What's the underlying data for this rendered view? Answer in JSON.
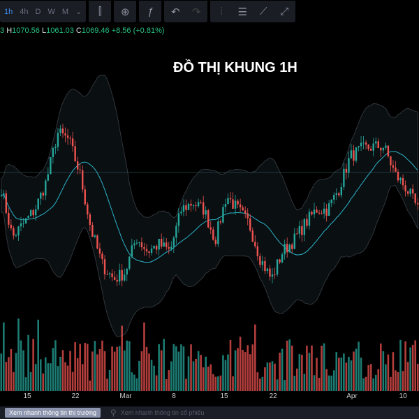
{
  "toolbar": {
    "intervals": [
      "1h",
      "4h",
      "D",
      "W",
      "M"
    ],
    "active_interval": "1h"
  },
  "ohlc": {
    "open_tail": "3",
    "h_label": "H",
    "high": "1070.56",
    "l_label": "L",
    "low": "1061.03",
    "c_label": "C",
    "close": "1069.46",
    "change": "+8.56 (+0.81%)"
  },
  "title": "ĐỒ THỊ KHUNG 1H",
  "x_labels": [
    {
      "t": "15",
      "p": 0.065
    },
    {
      "t": "22",
      "p": 0.18
    },
    {
      "t": "Mar",
      "p": 0.3
    },
    {
      "t": "8",
      "p": 0.415
    },
    {
      "t": "15",
      "p": 0.535
    },
    {
      "t": "22",
      "p": 0.652
    },
    {
      "t": "Apr",
      "p": 0.84
    },
    {
      "t": "10",
      "p": 0.962
    }
  ],
  "bottom": {
    "quick_market": "Xem nhanh thông tin thị trường",
    "search_placeholder": "Xem nhanh thông tin cổ phiếu"
  },
  "colors": {
    "up": "#26a69a",
    "down": "#ef5350",
    "ma": "#2bb3c8",
    "bg": "#000000"
  },
  "chart_data": {
    "type": "candlestick",
    "price_path": [
      1055,
      1020,
      1030,
      1040,
      1060,
      1095,
      1090,
      1065,
      1025,
      1000,
      990,
      995,
      1020,
      1010,
      1015,
      1010,
      1040,
      1045,
      1040,
      1018,
      1050,
      1040,
      1030,
      1005,
      990,
      1010,
      1018,
      1030,
      1040,
      1040,
      1055,
      1078,
      1083,
      1085,
      1085,
      1065,
      1055,
      1040
    ],
    "volume_seed": 7
  }
}
